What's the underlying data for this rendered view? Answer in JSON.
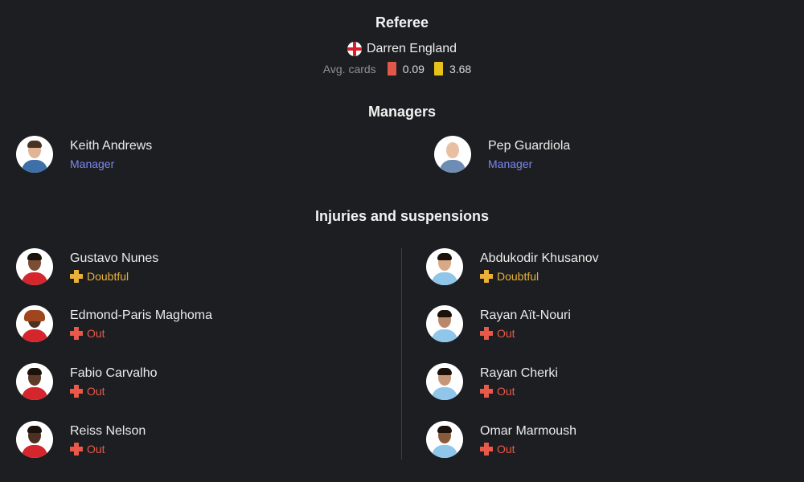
{
  "referee": {
    "section_title": "Referee",
    "flag_icon": "england-flag-icon",
    "name": "Darren England",
    "avg_cards_label": "Avg. cards",
    "red_cards_avg": "0.09",
    "yellow_cards_avg": "3.68",
    "colors": {
      "red_card": "#e0584a",
      "yellow_card": "#e8c21a"
    }
  },
  "managers": {
    "section_title": "Managers",
    "home": {
      "name": "Keith Andrews",
      "role": "Manager"
    },
    "away": {
      "name": "Pep Guardiola",
      "role": "Manager"
    }
  },
  "injuries": {
    "section_title": "Injuries and suspensions",
    "home": [
      {
        "name": "Gustavo Nunes",
        "status": "Doubtful"
      },
      {
        "name": "Edmond-Paris Maghoma",
        "status": "Out"
      },
      {
        "name": "Fabio Carvalho",
        "status": "Out"
      },
      {
        "name": "Reiss Nelson",
        "status": "Out"
      }
    ],
    "away": [
      {
        "name": "Abdukodir Khusanov",
        "status": "Doubtful"
      },
      {
        "name": "Rayan Aït-Nouri",
        "status": "Out"
      },
      {
        "name": "Rayan Cherki",
        "status": "Out"
      },
      {
        "name": "Omar Marmoush",
        "status": "Out"
      }
    ],
    "colors": {
      "doubtful": "#eab13a",
      "out": "#e8594a"
    }
  }
}
